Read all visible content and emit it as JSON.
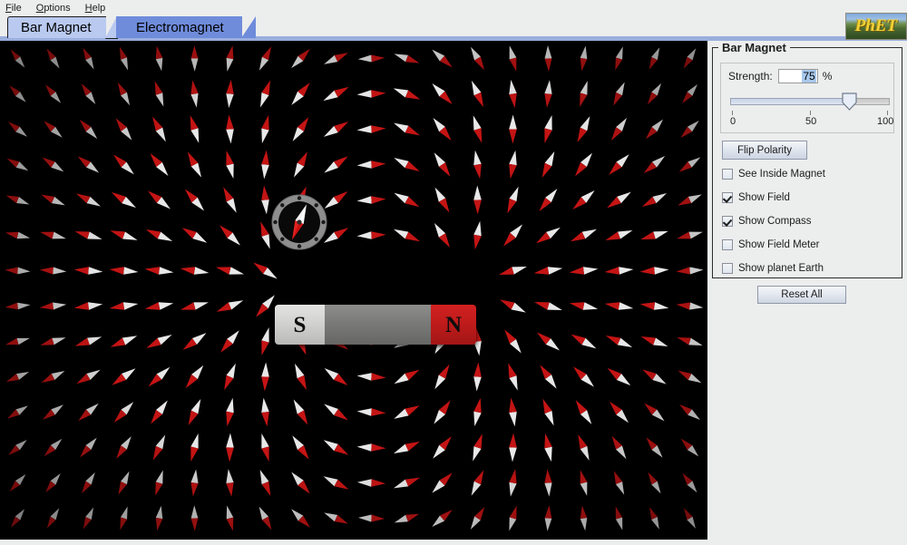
{
  "menubar": {
    "items": [
      {
        "label": "File",
        "mnemonic": "F"
      },
      {
        "label": "Options",
        "mnemonic": "O"
      },
      {
        "label": "Help",
        "mnemonic": "H"
      }
    ]
  },
  "tabs": [
    {
      "label": "Bar Magnet",
      "active": true
    },
    {
      "label": "Electromagnet",
      "active": false
    }
  ],
  "logo": {
    "text": "PhET"
  },
  "canvas": {
    "magnet": {
      "south_label": "S",
      "north_label": "N",
      "south_color": "#d2d2d0",
      "north_color": "#c01b1b",
      "middle_color": "#7a7a78"
    },
    "compass": {
      "needle_north_color": "#f2f2f2",
      "needle_south_color": "#cc1111",
      "ring_color": "#8e8e8e",
      "face_color": "#090909"
    },
    "field": {
      "background": "#000000",
      "arrow_north_color": "#e8e8e8",
      "arrow_south_color": "#c41414",
      "grid_spacing": 39
    }
  },
  "panel": {
    "title": "Bar Magnet",
    "strength": {
      "label": "Strength:",
      "value": "75",
      "unit": "%",
      "min_tick": "0",
      "mid_tick": "50",
      "max_tick": "100",
      "slider_percent": 75
    },
    "flip_polarity_label": "Flip Polarity",
    "checkboxes": [
      {
        "label": "See Inside Magnet",
        "checked": false
      },
      {
        "label": "Show Field",
        "checked": true
      },
      {
        "label": "Show Compass",
        "checked": true
      },
      {
        "label": "Show Field Meter",
        "checked": false
      },
      {
        "label": "Show planet Earth",
        "checked": false
      }
    ]
  },
  "reset_all_label": "Reset All"
}
